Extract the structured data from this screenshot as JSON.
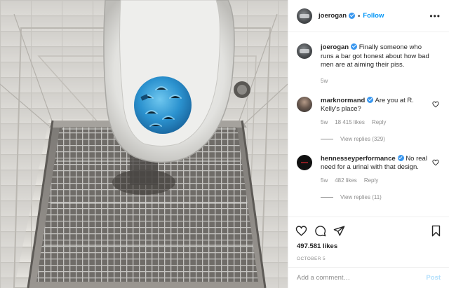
{
  "post": {
    "author": "joerogan",
    "follow_label": "Follow",
    "separator": "•",
    "more_label": "•••",
    "photo_alt": "Urinal with blue screen above a metal floor grate"
  },
  "caption": {
    "username": "joerogan",
    "text": "Finally someone who runs a bar got honest about how bad men are at aiming their piss.",
    "time": "5w"
  },
  "comments": [
    {
      "username": "marknormand",
      "verified": true,
      "text": "Are you at R. Kelly's place?",
      "time": "5w",
      "likes": "18 415 likes",
      "reply_label": "Reply",
      "view_replies": "View replies (329)"
    },
    {
      "username": "hennesseyperformance",
      "verified": true,
      "text": "No real need for a urinal with that design.",
      "time": "5w",
      "likes": "482 likes",
      "reply_label": "Reply",
      "view_replies": "View replies (11)"
    }
  ],
  "actions": {
    "icons": [
      "heart-icon",
      "comment-icon",
      "share-icon",
      "bookmark-icon"
    ],
    "likes": "497.581 likes",
    "date": "OCTOBER 5"
  },
  "add_comment": {
    "placeholder": "Add a comment…",
    "post_label": "Post"
  },
  "colors": {
    "accent": "#0095f6",
    "verified": "#3897f0",
    "post_disabled": "#b2dffc",
    "muted": "#8e8e8e"
  }
}
